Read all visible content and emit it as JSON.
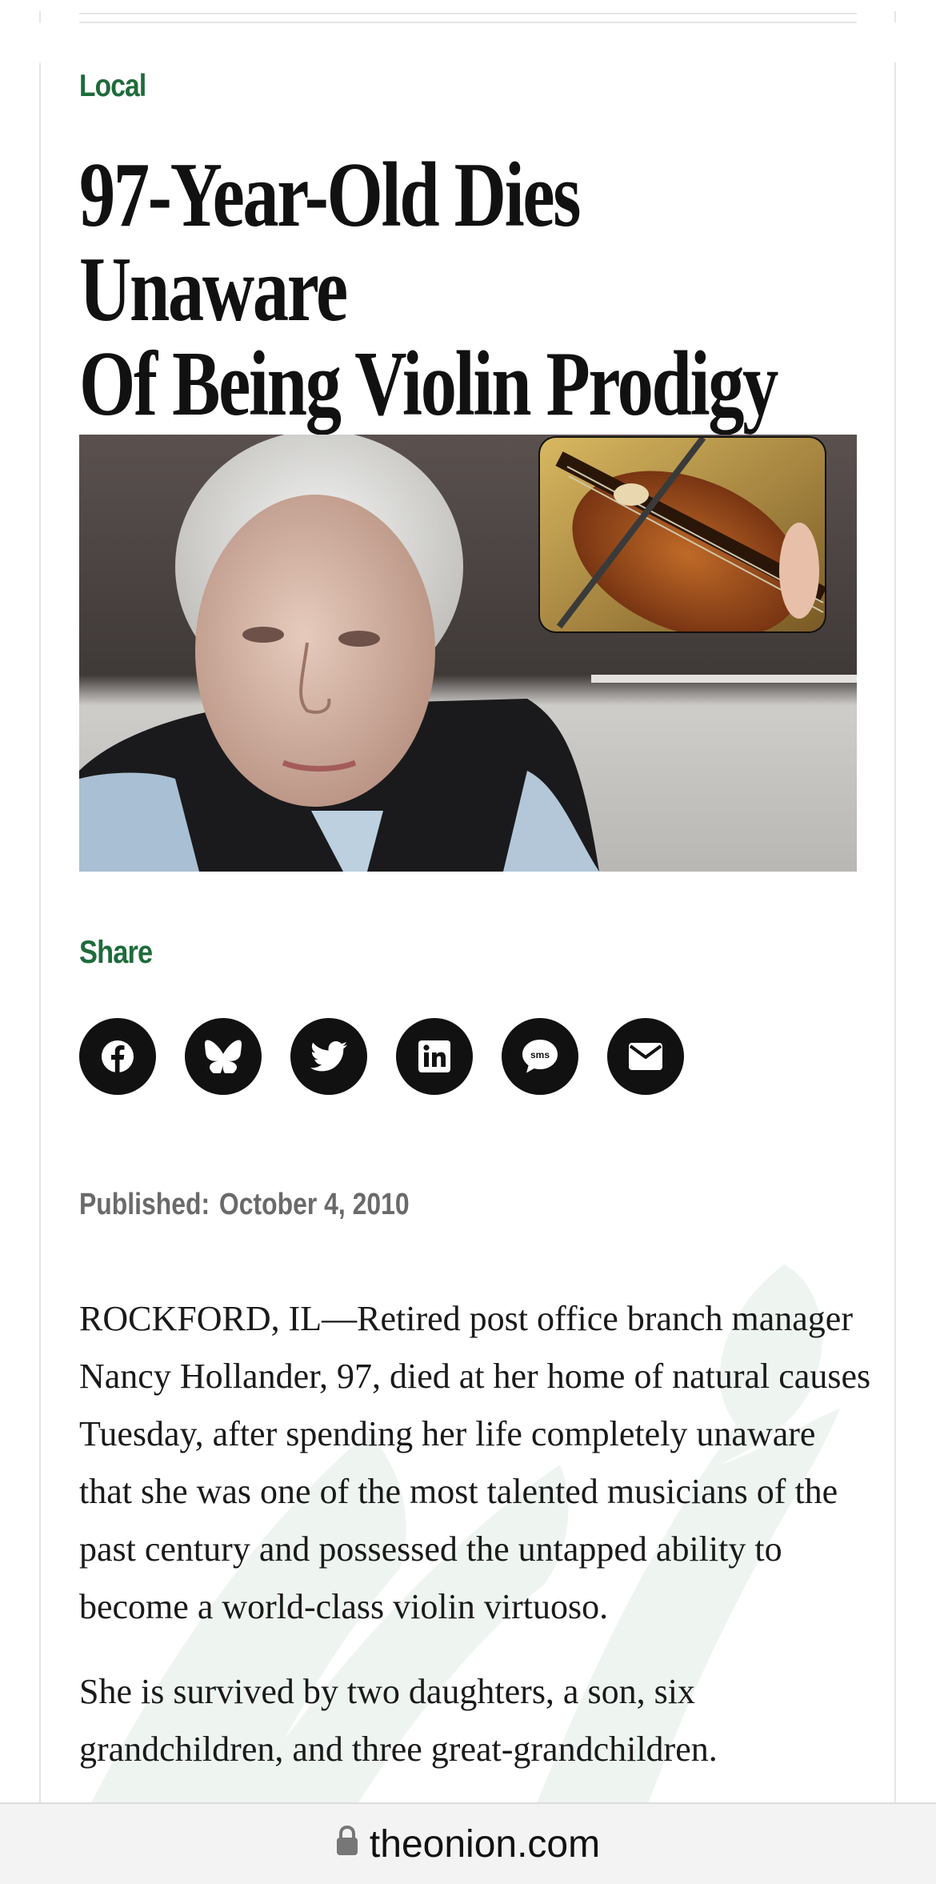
{
  "article": {
    "section": "Local",
    "headline_line1": "97-Year-Old Dies Unaware",
    "headline_line2": "Of Being Violin Prodigy",
    "share_label": "Share",
    "published_label": "Published:",
    "published_date": "October 4, 2010",
    "paragraphs": [
      "ROCKFORD, IL—Retired post office branch manager Nancy Hollander, 97, died at her home of natural causes Tuesday, after spending her life completely unaware that she was one of the most talented musicians of the past century and possessed the untapped ability to become a world-class violin virtuoso.",
      "She is survived by two daughters, a son, six grandchildren, and three great-grandchildren."
    ]
  },
  "share_buttons": [
    {
      "icon": "facebook-icon"
    },
    {
      "icon": "bluesky-icon"
    },
    {
      "icon": "twitter-icon"
    },
    {
      "icon": "linkedin-icon"
    },
    {
      "icon": "sms-icon",
      "text": "sms"
    },
    {
      "icon": "email-icon"
    }
  ],
  "browser": {
    "url": "theonion.com"
  },
  "colors": {
    "accent_green": "#1e6b3b",
    "text_dark": "#111111",
    "meta_gray": "#6a6a6a"
  }
}
